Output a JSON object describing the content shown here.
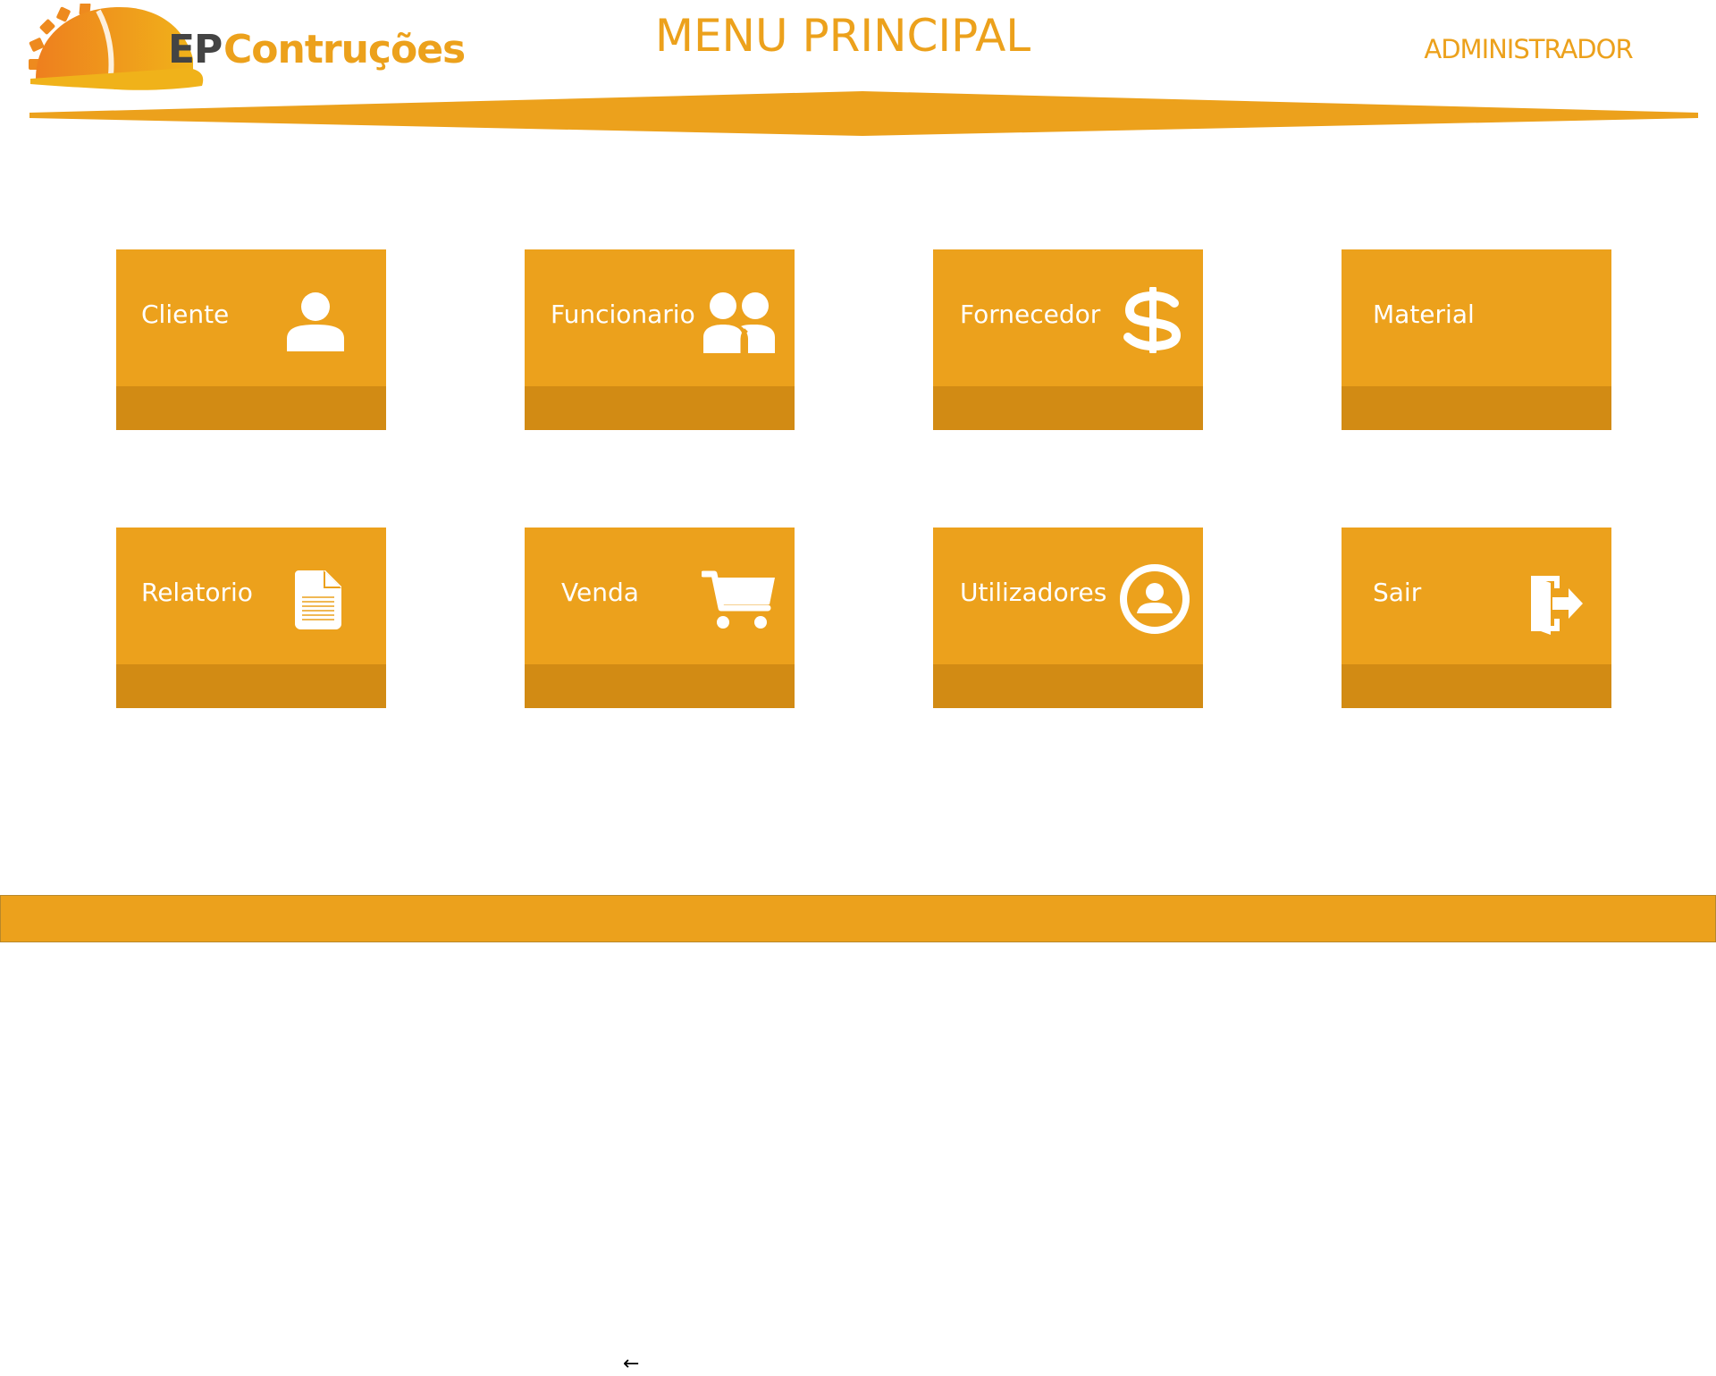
{
  "brand": {
    "prefix": "EP",
    "name": "Contruções"
  },
  "header": {
    "title": "MENU PRINCIPAL",
    "user_role": "ADMINISTRADOR"
  },
  "theme": {
    "accent": "#ECA11C",
    "accent_dark": "#D28B14",
    "text_dark": "#444444"
  },
  "menu": {
    "tiles": [
      {
        "label": "Cliente",
        "icon": "person-icon"
      },
      {
        "label": "Funcionario",
        "icon": "people-icon"
      },
      {
        "label": "Fornecedor",
        "icon": "dollar-icon"
      },
      {
        "label": "Material",
        "icon": ""
      },
      {
        "label": "Relatorio",
        "icon": "document-icon"
      },
      {
        "label": "Venda",
        "icon": "cart-icon"
      },
      {
        "label": "Utilizadores",
        "icon": "user-circle-icon"
      },
      {
        "label": "Sair",
        "icon": "exit-door-icon"
      }
    ]
  },
  "footer": {
    "back_symbol": "←"
  }
}
